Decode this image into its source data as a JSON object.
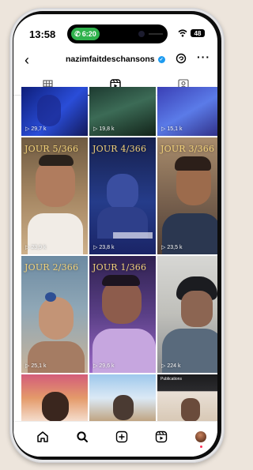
{
  "status_bar": {
    "time": "13:58",
    "call_time": "6:20",
    "battery": "48"
  },
  "header": {
    "username": "nazimfaitdeschansons",
    "verified": true
  },
  "tabs": [
    {
      "name": "grid",
      "icon": "grid-icon",
      "active": false
    },
    {
      "name": "reels",
      "icon": "reels-icon",
      "active": true
    },
    {
      "name": "tagged",
      "icon": "tagged-icon",
      "active": false
    }
  ],
  "reels": [
    {
      "views": "29,7 k",
      "caption": ""
    },
    {
      "views": "19,8 k",
      "caption": ""
    },
    {
      "views": "15,1 k",
      "caption": ""
    },
    {
      "views": "23,9 k",
      "caption": "JOUR 5/366"
    },
    {
      "views": "23,8 k",
      "caption": "JOUR 4/366"
    },
    {
      "views": "23,5 k",
      "caption": "JOUR 3/366"
    },
    {
      "views": "25,1 k",
      "caption": "JOUR 2/366"
    },
    {
      "views": "29,6 k",
      "caption": "JOUR 1/366"
    },
    {
      "views": "224 k",
      "caption": ""
    },
    {
      "views": "",
      "caption": ""
    },
    {
      "views": "",
      "caption": ""
    },
    {
      "views": "",
      "caption": "Publications"
    }
  ],
  "navbar": [
    {
      "name": "home",
      "icon": "home-icon"
    },
    {
      "name": "search",
      "icon": "search-icon"
    },
    {
      "name": "create",
      "icon": "plus-square-icon"
    },
    {
      "name": "reels",
      "icon": "reels-icon"
    },
    {
      "name": "profile",
      "icon": "avatar"
    }
  ],
  "colors": {
    "accent": "#1d9bf0",
    "call_green": "#2fb24c",
    "caption_gold": "#f3d27a"
  }
}
